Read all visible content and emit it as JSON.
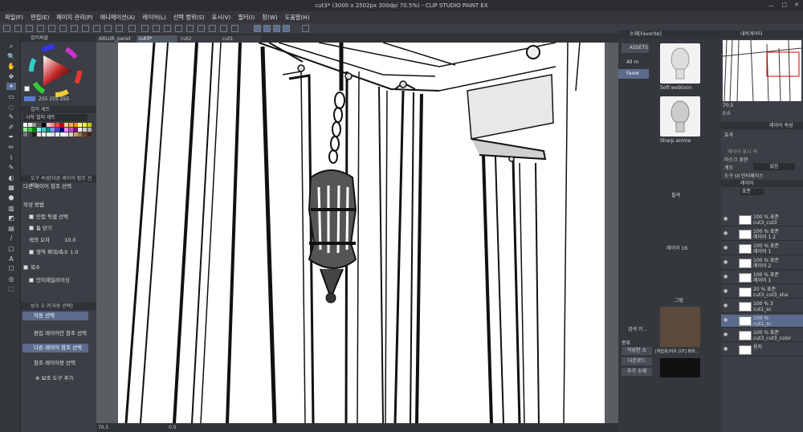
{
  "window": {
    "title": "cut3* (3000 x 2502px 300dpi 70.5%) - CLIP STUDIO PAINT EX"
  },
  "menu": [
    "파일(F)",
    "편집(E)",
    "페이지 관리(P)",
    "애니메이션(A)",
    "레이어(L)",
    "선택 범위(S)",
    "표시(V)",
    "필터(I)",
    "창(W)",
    "도움말(H)"
  ],
  "tabs": [
    "ABLUR_panel",
    "cut3*",
    "cut2",
    "cut1"
  ],
  "left_panel": {
    "color_header": "컬러써클",
    "color_values": "255  255  255",
    "set_header": "컬러 세트",
    "set_name": "시작 컬러 세트",
    "tool_prop_header": "도구 속성[다른 레이어 참조 선택]",
    "tool_name": "다른 레이어 참조 선택",
    "mode_label": "작성 방법",
    "opt_adjacent": "인접 픽셀 선택",
    "opt_close_gap": "틈 닫기",
    "tolerance_label": "색의 오차",
    "tolerance_value": "10.0",
    "expand_label": "영역 확대/축소",
    "expand_value": "1.0",
    "multi_label": "복수",
    "antialias_label": "안티에일리어싱",
    "sub_header": "보조 도구[자동 선택]",
    "auto_select_btn": "자동 선택",
    "sub_tools": [
      "편집 레이어만 참조 선택",
      "다른 레이어 참조 선택",
      "참조 레이어용 선택"
    ],
    "add_sub_tool": "보조 도구 추가"
  },
  "status": {
    "zoom": "70.5",
    "angle": "0.0"
  },
  "asset_panel": {
    "header": "소재[Favorite]",
    "asset_label": "ASSETS",
    "all_label": "All m",
    "fav_label": "Favor",
    "items": [
      "Soft webtoon",
      "Sharp anime",
      "필색",
      "레이어 16",
      "그림",
      "[체험용]자유 [CF] 찾파..."
    ],
    "search_label": "검색 키...",
    "type_label": "종류",
    "writer_label": "작성한 소",
    "download_label": "다운로드",
    "add_label": "추가 소재"
  },
  "right_panel": {
    "navigator_header": "내비게이터",
    "nav_zoom": "70.5",
    "nav_angle": "0.0",
    "effect_header": "레이어 속성",
    "effect_label": "효과",
    "layer_color_label": "레이어 표시 색",
    "mask_label": "마스크 표현",
    "blend_label": "계조",
    "blend_value": "없음",
    "tool_ui_label": "도구 UI 인터페이스",
    "layer_header": "레이어",
    "layer_mode": "표준",
    "layers": [
      {
        "pct": "100 % 표준",
        "name": "cut3_cut3"
      },
      {
        "pct": "100 % 표준",
        "name": "레이어 1 2"
      },
      {
        "pct": "100 % 표준",
        "name": "레이어 1"
      },
      {
        "pct": "100 % 표준",
        "name": "레이어 2"
      },
      {
        "pct": "100 % 표준",
        "name": "레이어 1"
      },
      {
        "pct": "20 % 표준",
        "name": "cut3_cut3_sha"
      },
      {
        "pct": "100 % 3",
        "name": "cut1_sc"
      },
      {
        "pct": "100 %",
        "name": "cut1_sc"
      },
      {
        "pct": "100 % 표준",
        "name": "cut3_cut3_color"
      },
      {
        "pct": "",
        "name": "용지"
      }
    ]
  }
}
